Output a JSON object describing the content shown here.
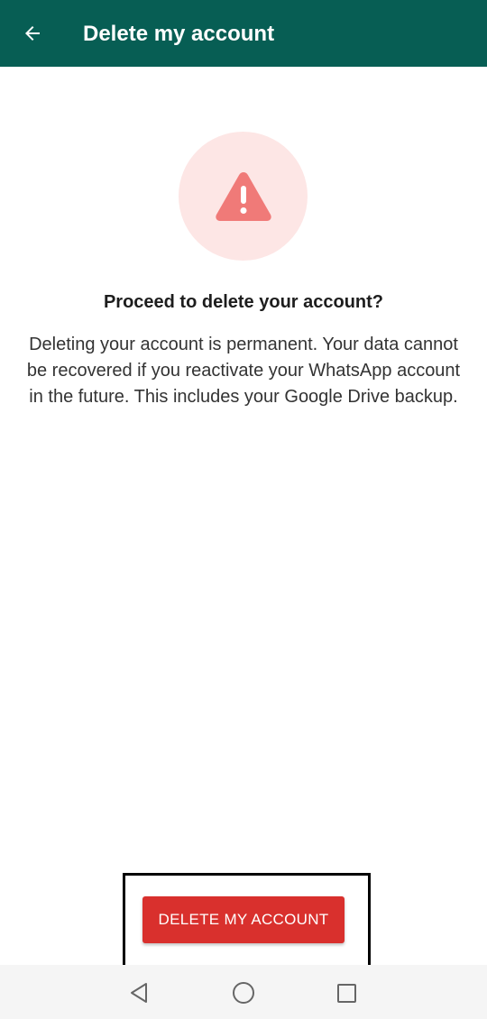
{
  "app_bar": {
    "title": "Delete my account",
    "back_icon": "arrow-left-icon",
    "background_color": "#075e54"
  },
  "warning": {
    "icon": "warning-triangle-icon",
    "circle_color": "#fde6e5",
    "icon_color": "#f07a78"
  },
  "content": {
    "question": "Proceed to delete your account?",
    "description": "Deleting your account is permanent. Your data cannot be recovered if you reactivate your WhatsApp account in the future. This includes your Google Drive backup."
  },
  "actions": {
    "delete_label": "DELETE MY ACCOUNT",
    "delete_color": "#d9302d"
  },
  "system_nav": {
    "back_icon": "triangle-back-icon",
    "home_icon": "circle-home-icon",
    "recents_icon": "square-recents-icon"
  }
}
